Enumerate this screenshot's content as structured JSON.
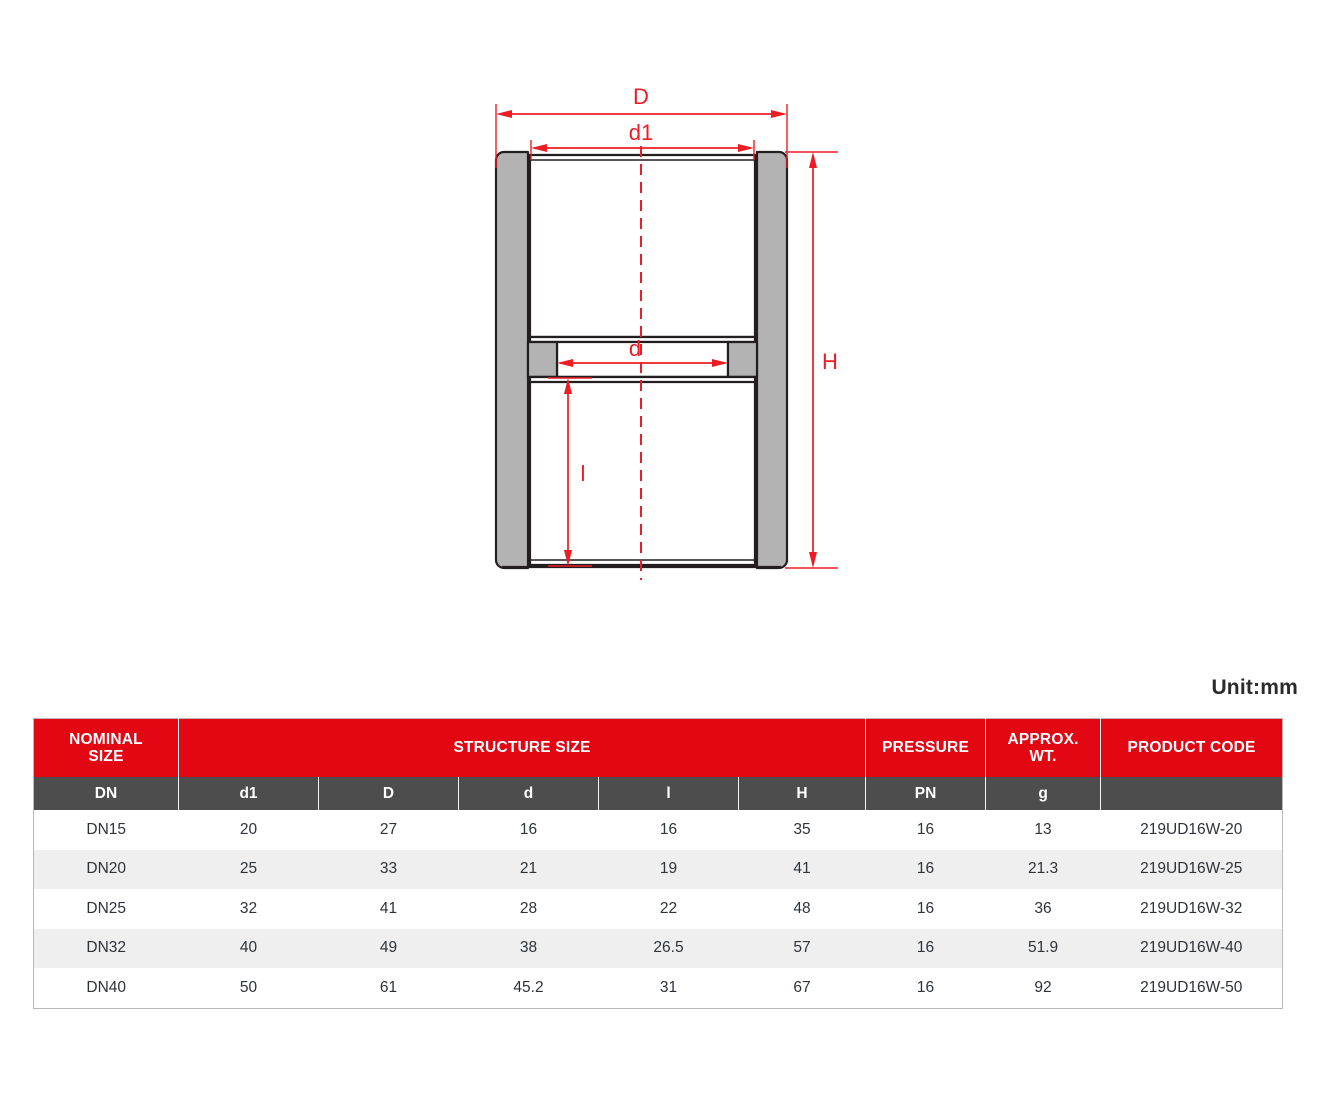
{
  "drawing": {
    "title": "pipe-fitting-socket-cross-section",
    "accent_red": "#ee1c24",
    "body_fill": "#b3b3b3",
    "outline": "#231f20",
    "dimension_labels": {
      "outer_diameter": "D",
      "socket_diameter": "d1",
      "inner_diameter": "d",
      "socket_depth": "l",
      "total_height": "H"
    }
  },
  "unit_note": "Unit:mm",
  "table": {
    "group_headers": [
      {
        "label": "NOMINAL\nSIZE",
        "line1": "NOMINAL",
        "line2": "SIZE"
      },
      {
        "label": "STRUCTURE SIZE"
      },
      {
        "label": "PRESSURE"
      },
      {
        "label": "APPROX.\nWT.",
        "line1": "APPROX.",
        "line2": "WT."
      },
      {
        "label": "PRODUCT CODE"
      }
    ],
    "group_nominal": "NOMINAL",
    "group_nominal_2": "SIZE",
    "group_structure": "STRUCTURE SIZE",
    "group_pressure": "PRESSURE",
    "group_wt": "APPROX.",
    "group_wt_2": "WT.",
    "group_code": "PRODUCT CODE",
    "symbols": {
      "dn": "DN",
      "d1": "d1",
      "D": "D",
      "d": "d",
      "l": "l",
      "H": "H",
      "pn": "PN",
      "g": "g",
      "code": ""
    },
    "rows": [
      {
        "dn": "DN15",
        "d1": "20",
        "D": "27",
        "d": "16",
        "l": "16",
        "H": "35",
        "pn": "16",
        "wt": "13",
        "code": "219UD16W-20"
      },
      {
        "dn": "DN20",
        "d1": "25",
        "D": "33",
        "d": "21",
        "l": "19",
        "H": "41",
        "pn": "16",
        "wt": "21.3",
        "code": "219UD16W-25"
      },
      {
        "dn": "DN25",
        "d1": "32",
        "D": "41",
        "d": "28",
        "l": "22",
        "H": "48",
        "pn": "16",
        "wt": "36",
        "code": "219UD16W-32"
      },
      {
        "dn": "DN32",
        "d1": "40",
        "D": "49",
        "d": "38",
        "l": "26.5",
        "H": "57",
        "pn": "16",
        "wt": "51.9",
        "code": "219UD16W-40"
      },
      {
        "dn": "DN40",
        "d1": "50",
        "D": "61",
        "d": "45.2",
        "l": "31",
        "H": "67",
        "pn": "16",
        "wt": "92",
        "code": "219UD16W-50"
      }
    ],
    "colors": {
      "header_red": "#e30613",
      "header_gray": "#4d4d4d",
      "row_alt": "#efefef",
      "border": "#b9b9b9"
    }
  }
}
